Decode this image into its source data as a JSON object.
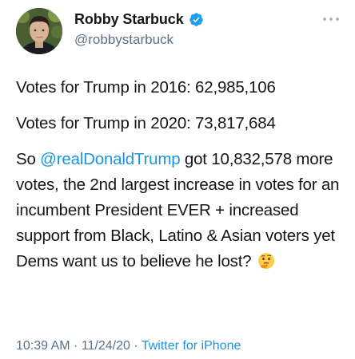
{
  "author": {
    "display_name": "Robby Starbuck",
    "handle": "@robbystarbuck",
    "verified": true
  },
  "tweet": {
    "line1": "Votes for Trump in 2016: 62,985,106",
    "line2": "Votes for Trump in 2020: 73,817,684",
    "p3_before": "So ",
    "p3_mention": "@realDonaldTrump",
    "p3_after": " got 10,832,578 more votes, the 2nd largest increase in votes for an incumbent President EVER + increased support from Black, Latino & Asian voters yet Dems want us to believe he lost?",
    "emoji": "thinking-face-icon"
  },
  "meta": {
    "time": "10:39 AM",
    "separator1": " · ",
    "date": "11/24/20",
    "separator2": " · ",
    "source": "Twitter for iPhone"
  },
  "colors": {
    "link": "#1b95e0",
    "muted": "#5b7083",
    "text": "#14171a",
    "verified": "#1da1f2"
  }
}
